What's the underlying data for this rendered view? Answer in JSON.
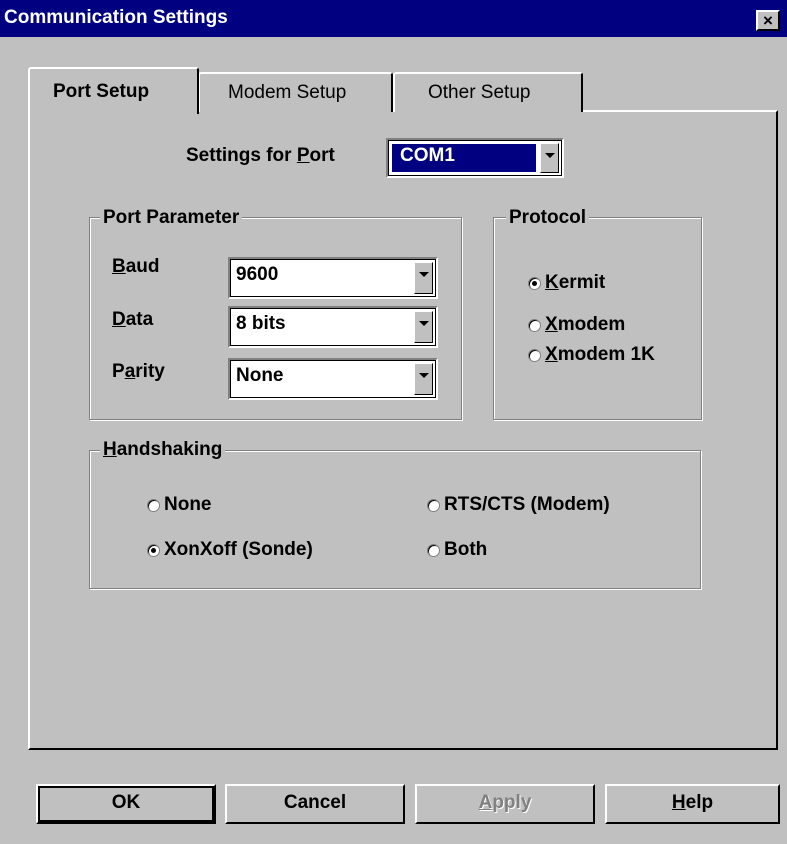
{
  "window": {
    "title": "Communication Settings",
    "close_glyph": "×"
  },
  "tabs": [
    {
      "label": "Port Setup",
      "active": true
    },
    {
      "label": "Modem Setup",
      "active": false
    },
    {
      "label": "Other Setup",
      "active": false
    }
  ],
  "port": {
    "label_prefix": "Settings for ",
    "label_access": "P",
    "label_suffix": "ort",
    "value": "COM1"
  },
  "port_parameter": {
    "title": "Port Parameter",
    "baud": {
      "label_access": "B",
      "label_rest": "aud",
      "value": "9600"
    },
    "data": {
      "label_access": "D",
      "label_rest": "ata",
      "value": "8 bits"
    },
    "parity": {
      "label_pre": "P",
      "label_access": "a",
      "label_rest": "rity",
      "value": "None"
    }
  },
  "protocol": {
    "title": "Protocol",
    "options": [
      {
        "access": "K",
        "rest": "ermit",
        "selected": true
      },
      {
        "access": "X",
        "rest": "modem",
        "selected": false
      },
      {
        "access": "X",
        "rest": "modem 1K",
        "selected": false
      }
    ]
  },
  "handshaking": {
    "title_access": "H",
    "title_rest": "andshaking",
    "options": [
      {
        "label": "None",
        "selected": false
      },
      {
        "label": "RTS/CTS (Modem)",
        "selected": false
      },
      {
        "label": "XonXoff (Sonde)",
        "selected": true
      },
      {
        "label": "Both",
        "selected": false
      }
    ]
  },
  "buttons": {
    "ok": "OK",
    "cancel": "Cancel",
    "apply_access": "A",
    "apply_rest": "pply",
    "help_access": "H",
    "help_rest": "elp"
  }
}
